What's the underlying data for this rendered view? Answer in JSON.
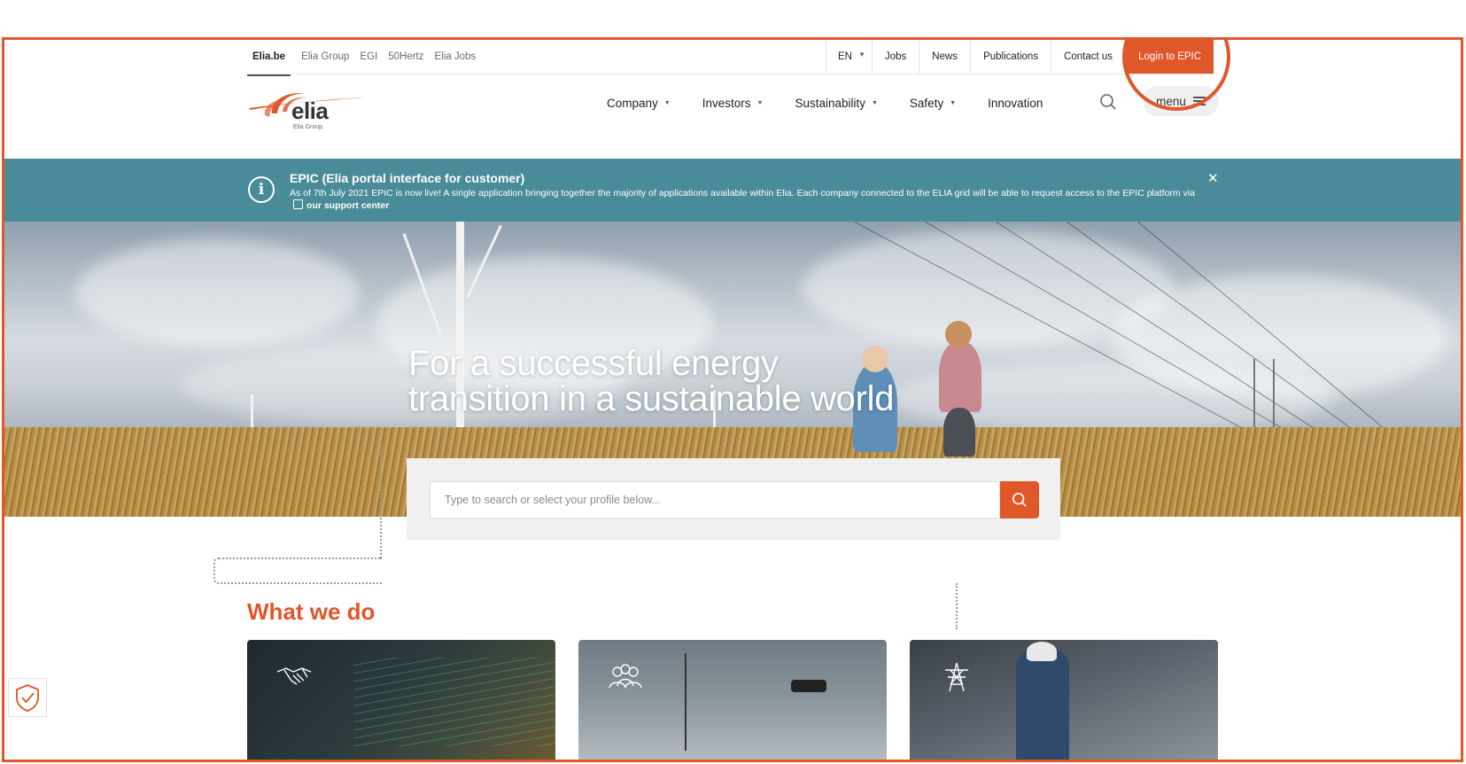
{
  "utility_nav": {
    "left_links": [
      "Elia.be",
      "Elia Group",
      "EGI",
      "50Hertz",
      "Elia Jobs"
    ],
    "language": "EN",
    "right_links": [
      "Jobs",
      "News",
      "Publications",
      "Contact us"
    ],
    "cta": "Login to EPIC"
  },
  "logo": {
    "word": "elia",
    "sub": "Elia Group"
  },
  "main_nav": {
    "items": [
      {
        "label": "Company",
        "dropdown": true
      },
      {
        "label": "Investors",
        "dropdown": true
      },
      {
        "label": "Sustainability",
        "dropdown": true
      },
      {
        "label": "Safety",
        "dropdown": true
      },
      {
        "label": "Innovation",
        "dropdown": false
      }
    ],
    "menu_label": "menu"
  },
  "banner": {
    "title": "EPIC (Elia portal interface for customer)",
    "text": "As of 7th July 2021 EPIC is now live! A single application bringing together the majority of applications available within Elia. Each company connected to the ELIA grid will be able to request access to the EPIC platform via",
    "link": "our support center"
  },
  "hero": {
    "title": "For a successful energy transition in a sustainable world"
  },
  "search": {
    "placeholder": "Type to search or select your profile below..."
  },
  "section": {
    "title": "What we do"
  },
  "icons": [
    "handshake-icon",
    "people-icon",
    "pylon-icon",
    "search-icon",
    "info-icon",
    "close-icon",
    "shield-check-icon"
  ],
  "colors": {
    "accent": "#e0572a",
    "banner": "#4a8b99"
  }
}
